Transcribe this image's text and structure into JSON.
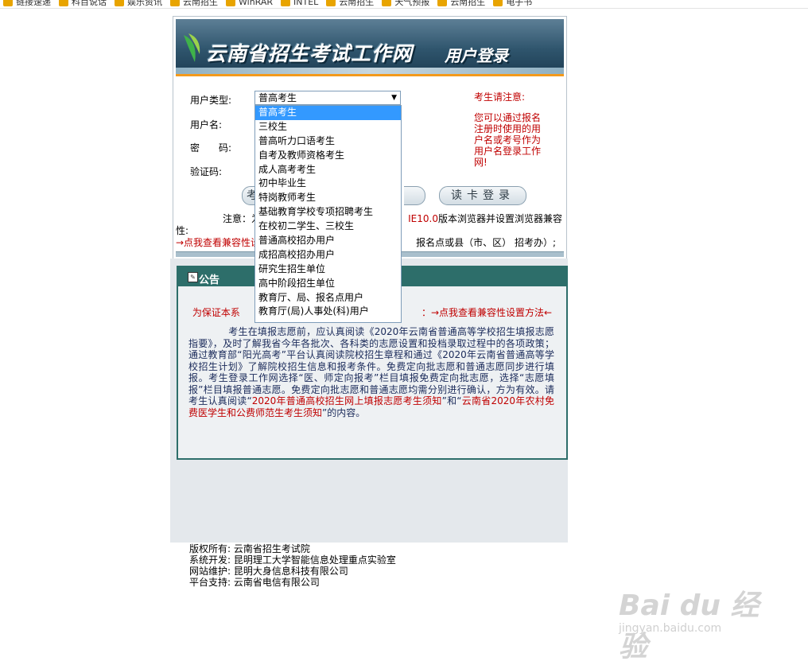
{
  "bookmarks": [
    {
      "label": "链接速递"
    },
    {
      "label": "科目说话"
    },
    {
      "label": "娱乐资讯"
    },
    {
      "label": "云南招生"
    },
    {
      "label": "WinRAR"
    },
    {
      "label": "INTEL"
    },
    {
      "label": "云南招生"
    },
    {
      "label": "天气预报"
    },
    {
      "label": "云南招生"
    },
    {
      "label": "电子书"
    }
  ],
  "header": {
    "site_title": "云南省招生考试工作网",
    "subtitle": "用户登录"
  },
  "login": {
    "user_type_label": "用户类型:",
    "username_label": "用户名:",
    "password_label": "密　　码:",
    "captcha_label": "验证码:",
    "selected_type": "普高考生",
    "login_button": "考",
    "read_card_button": "读卡登录",
    "notice_title": "考生请注意:",
    "notice_body": "您可以通过报名注册时使用的用户名或考号作为用户名登录工作网!",
    "compat_prefix": "注意：为",
    "compat_ie": "IE10.0",
    "compat_suffix": "版本浏览器并设置浏览器兼容",
    "compat_line2": "性:",
    "compat_link": "→点我查看兼容性设",
    "compat_tail": "报名点或县（市、区） 招考办）;"
  },
  "dropdown": {
    "options": [
      "普高考生",
      "三校生",
      "普高听力口语考生",
      "自考及教师资格考生",
      "成人高考考生",
      "初中毕业生",
      "特岗教师考生",
      "基础教育学校专项招聘考生",
      "在校初二学生、三校生",
      "普通高校招办用户",
      "成招高校招办用户",
      "研究生招生单位",
      "高中阶段招生单位",
      "教育厅、局、报名点用户",
      "教育厅(局)人事处(科)用户"
    ],
    "selected_index": 0
  },
  "notice": {
    "title": "公告",
    "red_line_left": "为保证本系",
    "red_line_right": "：→点我查看兼容性设置方法←",
    "body_1": "考生在填报志愿前，应认真阅读《2020年云南省普通高等学校招生填报志愿指要》，及时了解我省今年各批次、各科类的志愿设置和投档录取过程中的各项政策；通过教育部“阳光高考”平台认真阅读院校招生章程和通过《2020年云南省普通高等学校招生计划》了解院校招生信息和报考条件。免费定向批志愿和普通志愿同步进行填报。考生登录工作网选择“医、师定向报考”栏目填报免费定向批志愿，选择“志愿填报”栏目填报普通志愿。免费定向批志愿和普通志愿均需分别进行确认，方为有效。请考生认真阅读“",
    "body_red_1": "2020年普通高校招生网上填报志愿考生须知",
    "body_mid": "”和“",
    "body_red_2": "云南省2020年农村免费医学生和公费师范生考生须知",
    "body_end": "”的内容。"
  },
  "footer": {
    "line1": "版权所有: 云南省招生考试院",
    "line2": "系统开发: 昆明理工大学智能信息处理重点实验室",
    "line3": "网站维护: 昆明大身信息科技有限公司",
    "line4": "平台支持: 云南省电信有限公司"
  },
  "watermark": {
    "text": "Bai du 经验",
    "url": "jingyan.baidu.com"
  }
}
